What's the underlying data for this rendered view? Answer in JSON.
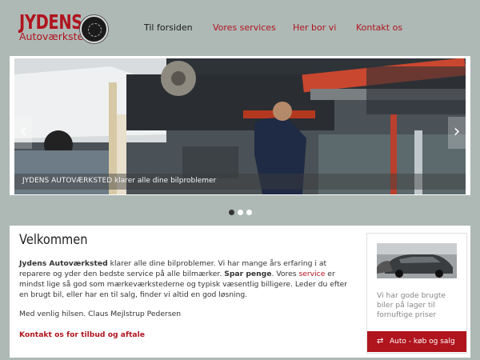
{
  "logo": {
    "name": "JYDENS",
    "subtitle": "Autoværksted"
  },
  "nav": [
    {
      "label": "Til forsiden",
      "active": true
    },
    {
      "label": "Vores services",
      "active": false
    },
    {
      "label": "Her bor vi",
      "active": false
    },
    {
      "label": "Kontakt os",
      "active": false
    }
  ],
  "slider": {
    "caption": "JYDENS AUTOVÆRKSTED klarer alle dine bilproblemer",
    "prev_icon": "‹",
    "next_icon": "›",
    "slide_count": 3,
    "active_slide": 1
  },
  "welcome": {
    "title": "Velkommen",
    "brand": "Jydens Autoværksted",
    "text1": " klarer alle dine bilproblemer. Vi har mange års erfaring i at reparere og yder den bedste service på alle bilmærker. ",
    "emph": "Spar penge",
    "text2": ". Vores ",
    "service_link": "service",
    "text3": " er mindst lige så god som mærkeværkstederne og typisk væsentlig billigere. Leder du efter en brugt bil, eller har en til salg, finder vi altid en god løsning.",
    "greeting": "Med venlig hilsen. Claus Mejlstrup Pedersen",
    "cta": "Kontakt os for tilbud og aftale"
  },
  "sidebar": {
    "text": "Vi har gode brugte biler på lager til fornuftige priser",
    "button_label": "Auto - køb og salg",
    "button_icon": "⇄"
  },
  "colors": {
    "accent": "#b0141d",
    "frame": "#aeb9b6"
  }
}
